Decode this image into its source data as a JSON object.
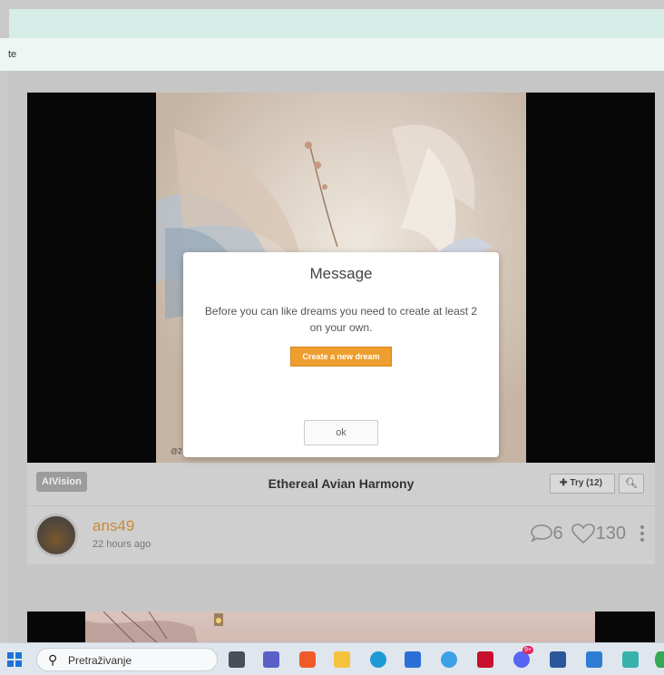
{
  "browser": {
    "address_fragment": "te"
  },
  "card": {
    "badge": "AIVision",
    "title": "Ethereal Avian Harmony",
    "try_label": "Try (12)",
    "author": "ans49",
    "time_ago": "22 hours ago",
    "comments": "6",
    "likes": "130",
    "watermark": "@2"
  },
  "modal": {
    "title": "Message",
    "body": "Before you can like dreams you need to create at least 2 on your own.",
    "create_label": "Create a new dream",
    "ok_label": "ok"
  },
  "taskbar": {
    "search_placeholder": "Pretraživanje",
    "icons": [
      "windows-start-icon",
      "task-view-icon",
      "teams-icon",
      "brave-icon",
      "file-explorer-icon",
      "edge-icon",
      "microsoft-store-icon",
      "app-icon",
      "mcafee-icon",
      "discord-icon",
      "word-icon",
      "photos-icon",
      "notepad-icon",
      "chrome-icon"
    ],
    "discord_badge": "9+"
  },
  "colors": {
    "accent": "#ee9e2e",
    "username": "#c98a3c"
  }
}
